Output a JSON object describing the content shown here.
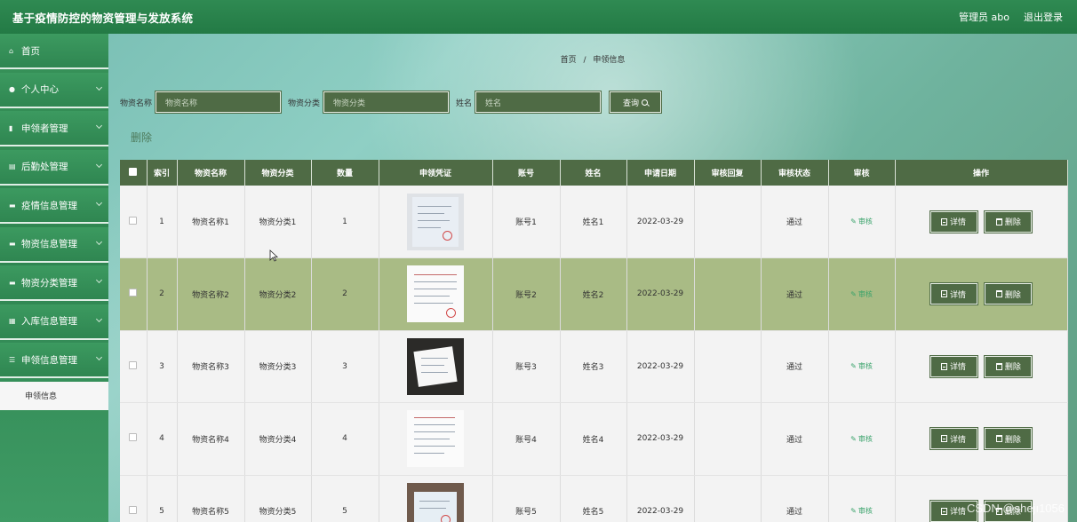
{
  "header": {
    "title": "基于疫情防控的物资管理与发放系统",
    "user": "管理员 abo",
    "logout": "退出登录"
  },
  "sidebar": {
    "items": [
      {
        "label": "首页",
        "icon": "home-icon",
        "expandable": false
      },
      {
        "label": "个人中心",
        "icon": "user-icon",
        "expandable": true
      },
      {
        "label": "申领者管理",
        "icon": "chart-icon",
        "expandable": true
      },
      {
        "label": "后勤处管理",
        "icon": "list-icon",
        "expandable": true
      },
      {
        "label": "疫情信息管理",
        "icon": "message-icon",
        "expandable": true
      },
      {
        "label": "物资信息管理",
        "icon": "box-icon",
        "expandable": true
      },
      {
        "label": "物资分类管理",
        "icon": "doc-icon",
        "expandable": true
      },
      {
        "label": "入库信息管理",
        "icon": "grid-icon",
        "expandable": true
      },
      {
        "label": "申领信息管理",
        "icon": "menu-icon",
        "expandable": true
      }
    ],
    "subitem": "申领信息"
  },
  "breadcrumb": {
    "home": "首页",
    "sep": "/",
    "current": "申领信息"
  },
  "search": {
    "fields": [
      {
        "label": "物资名称",
        "placeholder": "物资名称"
      },
      {
        "label": "物资分类",
        "placeholder": "物资分类"
      },
      {
        "label": "姓名",
        "placeholder": "姓名"
      }
    ],
    "button": "查询"
  },
  "bulk_delete": "删除",
  "table": {
    "headers": [
      "",
      "索引",
      "物资名称",
      "物资分类",
      "数量",
      "申领凭证",
      "账号",
      "姓名",
      "申请日期",
      "审核回复",
      "审核状态",
      "审核",
      "操作"
    ],
    "rows": [
      {
        "index": "1",
        "name": "物资名称1",
        "category": "物资分类1",
        "qty": "1",
        "account": "账号1",
        "person": "姓名1",
        "date": "2022-03-29",
        "reply": "",
        "status": "通过",
        "audit": "审核"
      },
      {
        "index": "2",
        "name": "物资名称2",
        "category": "物资分类2",
        "qty": "2",
        "account": "账号2",
        "person": "姓名2",
        "date": "2022-03-29",
        "reply": "",
        "status": "通过",
        "audit": "审核"
      },
      {
        "index": "3",
        "name": "物资名称3",
        "category": "物资分类3",
        "qty": "3",
        "account": "账号3",
        "person": "姓名3",
        "date": "2022-03-29",
        "reply": "",
        "status": "通过",
        "audit": "审核"
      },
      {
        "index": "4",
        "name": "物资名称4",
        "category": "物资分类4",
        "qty": "4",
        "account": "账号4",
        "person": "姓名4",
        "date": "2022-03-29",
        "reply": "",
        "status": "通过",
        "audit": "审核"
      },
      {
        "index": "5",
        "name": "物资名称5",
        "category": "物资分类5",
        "qty": "5",
        "account": "账号5",
        "person": "姓名5",
        "date": "2022-03-29",
        "reply": "",
        "status": "通过",
        "audit": "审核"
      }
    ],
    "detail_label": "详情",
    "delete_label": "删除"
  },
  "watermark": "CSDN @shejı1056",
  "colors": {
    "header": "#2b8550",
    "sidebar": "#38935a",
    "button": "#4f6b45",
    "highlight_row": "#a9bb85"
  }
}
